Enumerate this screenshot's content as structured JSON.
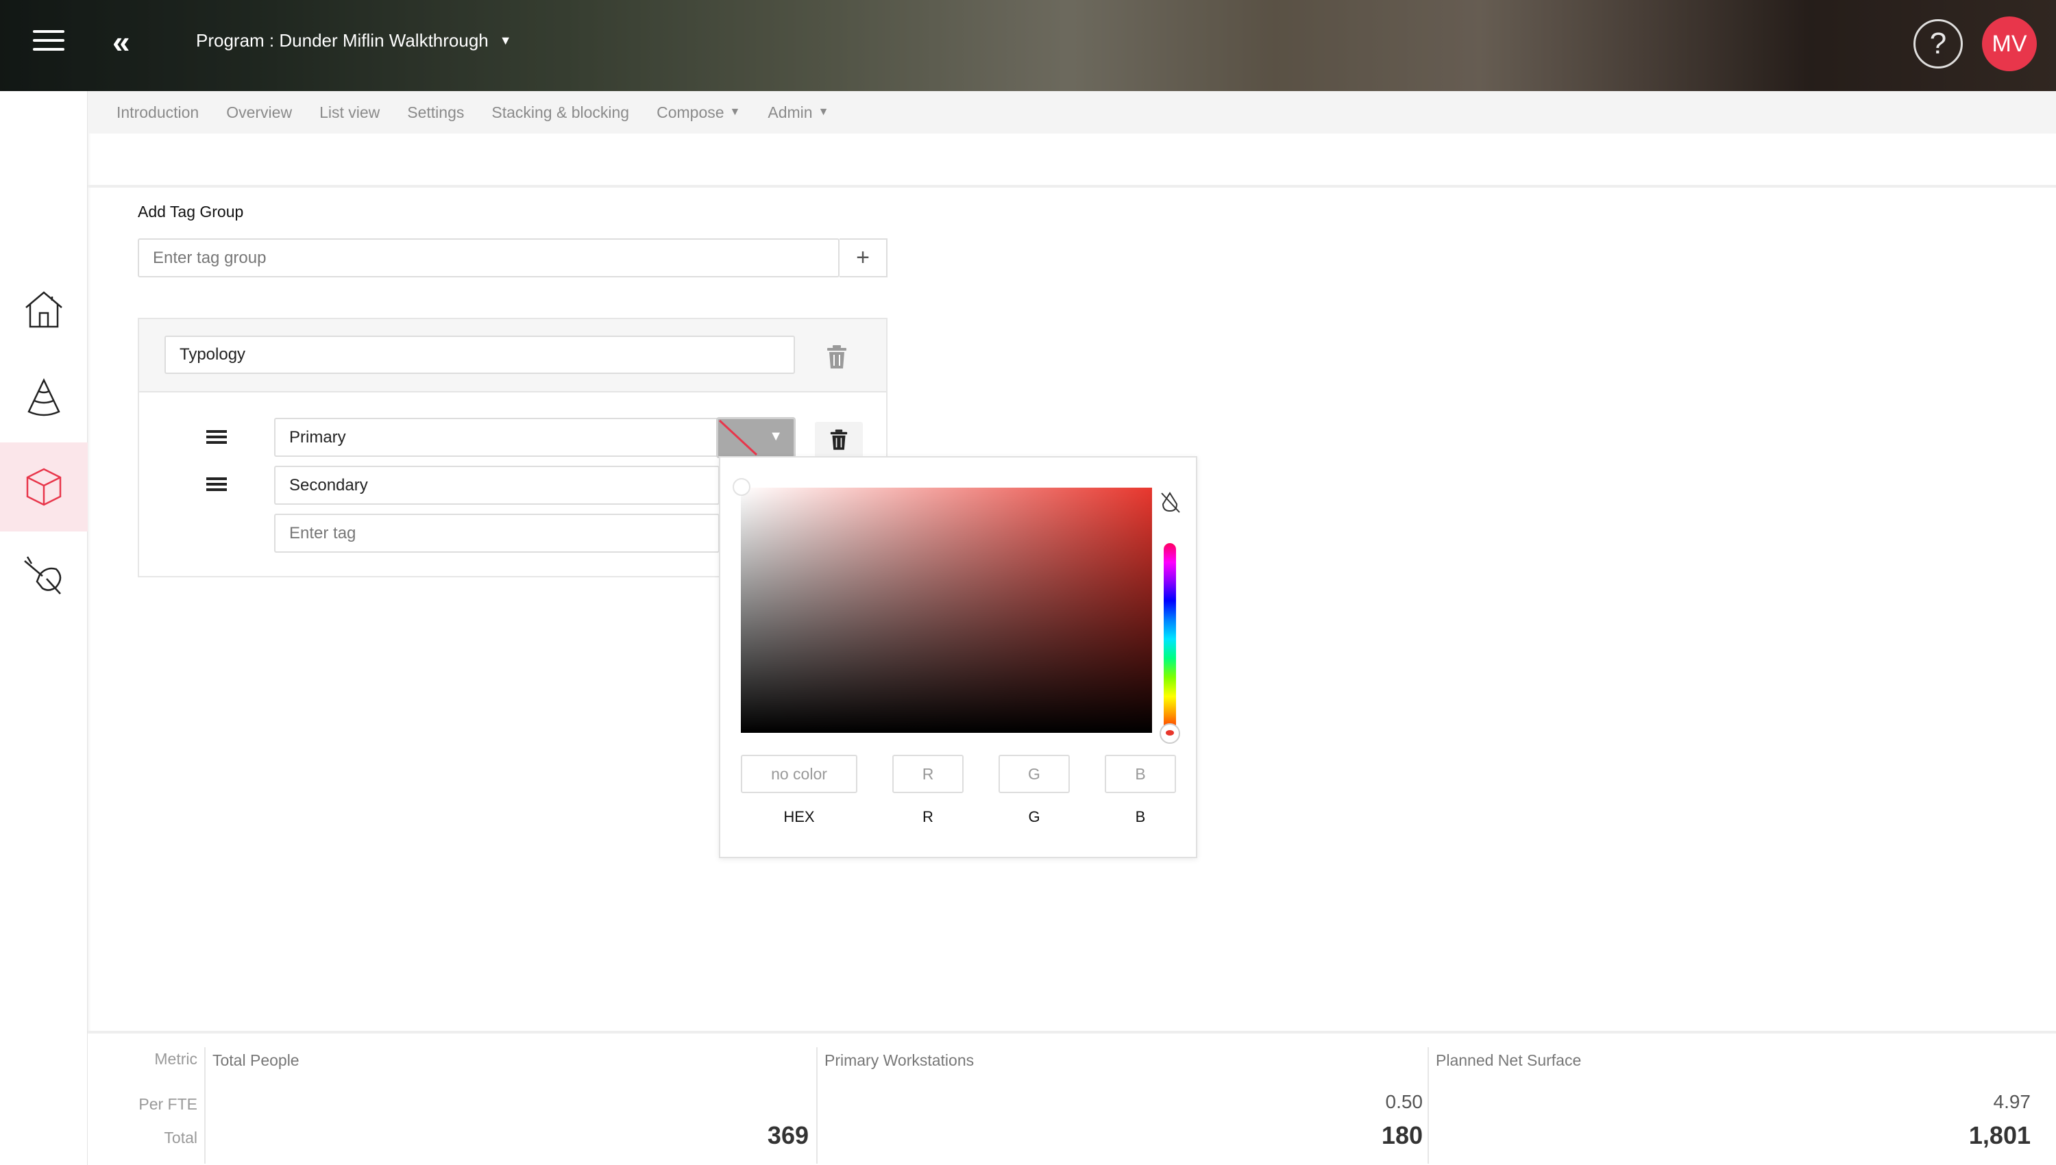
{
  "header": {
    "program_label": "Program : Dunder Miflin Walkthrough",
    "help_label": "?",
    "avatar_initials": "MV",
    "avatar_color": "#e8364b"
  },
  "sidebar": {
    "items": [
      {
        "name": "home",
        "icon": "home-icon"
      },
      {
        "name": "massing",
        "icon": "cone-icon"
      },
      {
        "name": "blocks",
        "icon": "cube-icon",
        "active": true
      },
      {
        "name": "design",
        "icon": "brush-icon"
      }
    ]
  },
  "subnav": {
    "items": [
      {
        "label": "Introduction"
      },
      {
        "label": "Overview"
      },
      {
        "label": "List view"
      },
      {
        "label": "Settings"
      },
      {
        "label": "Stacking & blocking"
      },
      {
        "label": "Compose"
      },
      {
        "label": "Admin"
      }
    ]
  },
  "form": {
    "add_tag_group_label": "Add Tag Group",
    "tag_group_placeholder": "Enter tag group",
    "add_button": "+",
    "group": {
      "name": "Typology",
      "tags": [
        {
          "value": "Primary"
        },
        {
          "value": "Secondary"
        }
      ],
      "new_tag_placeholder": "Enter tag"
    }
  },
  "color_picker": {
    "hex_placeholder": "no color",
    "r_placeholder": "R",
    "g_placeholder": "G",
    "b_placeholder": "B",
    "labels": {
      "hex": "HEX",
      "r": "R",
      "g": "G",
      "b": "B"
    },
    "hue_color": "#e8372e"
  },
  "footer": {
    "row_labels": {
      "metric": "Metric",
      "per_fte": "Per FTE",
      "total": "Total"
    },
    "metrics": [
      {
        "title": "Total People",
        "per_fte": "",
        "total": "369"
      },
      {
        "title": "Primary Workstations",
        "per_fte": "0.50",
        "total": "180"
      },
      {
        "title": "Planned Net Surface",
        "per_fte": "4.97",
        "total": "1,801"
      }
    ]
  }
}
